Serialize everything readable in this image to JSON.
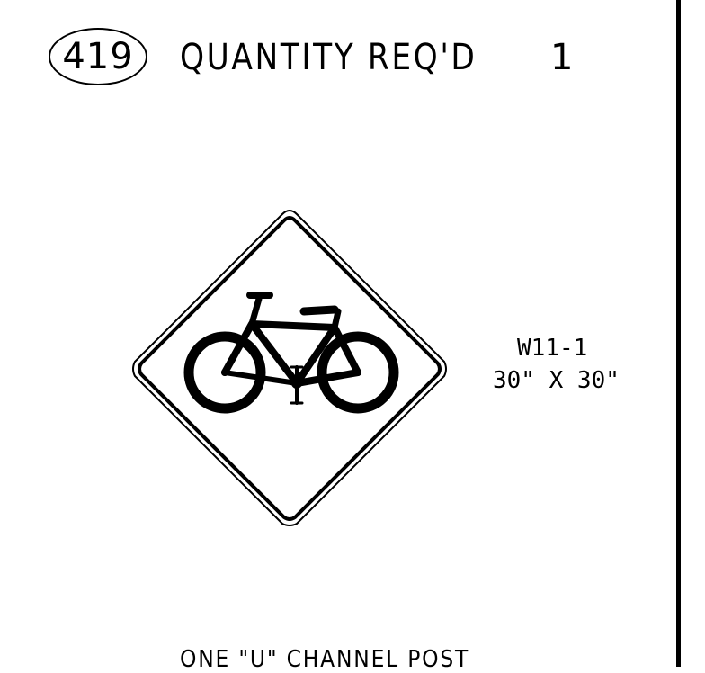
{
  "sheet": {
    "item_number": "419",
    "quantity_label": "QUANTITY REQ'D",
    "quantity_value": "1"
  },
  "sign": {
    "code": "W11-1",
    "size": "30\" X 30\"",
    "symbol": "bicycle-icon",
    "shape": "diamond"
  },
  "mounting": {
    "note": "ONE \"U\" CHANNEL POST"
  },
  "colors": {
    "ink": "#000000",
    "background": "#ffffff"
  }
}
